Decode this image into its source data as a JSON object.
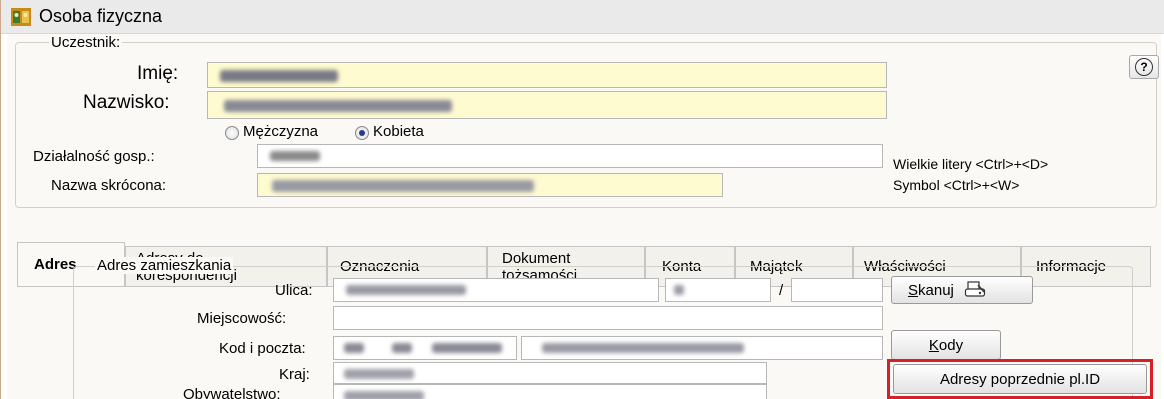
{
  "window": {
    "title": "Osoba fizyczna"
  },
  "participant": {
    "group_label": "Uczestnik:",
    "first_name_label": "Imię:",
    "last_name_label": "Nazwisko:",
    "gender_options": [
      {
        "label": "Mężczyzna",
        "selected": false
      },
      {
        "label": "Kobieta",
        "selected": true
      }
    ],
    "business_label": "Działalność gosp.:",
    "short_name_label": "Nazwa skrócona:",
    "hint_uppercase": "Wielkie litery <Ctrl>+<D>",
    "hint_symbol": "Symbol <Ctrl>+<W>",
    "help_glyph": "?"
  },
  "tabs": [
    {
      "label": "Adres",
      "active": true
    },
    {
      "label_line1": "Adresy do",
      "label_line2": "korespondencji"
    },
    {
      "label": "Oznaczenia"
    },
    {
      "label_line1": "Dokument",
      "label_line2": "tożsamości"
    },
    {
      "label": "Konta"
    },
    {
      "label": "Majątek"
    },
    {
      "label": "Właściwości"
    },
    {
      "label": "Informacje"
    }
  ],
  "address": {
    "group_label": "Adres zamieszkania",
    "street_label": "Ulica:",
    "slash": "/",
    "city_label": "Miejscowość:",
    "postal_label": "Kod i poczta:",
    "country_label": "Kraj:",
    "citizenship_label": "Obywatelstwo:",
    "scan_button": "Skanuj",
    "codes_button": "Kody",
    "prev_addresses_button": "Adresy poprzednie pl.ID"
  },
  "colors": {
    "highlight": "#d61f26",
    "field_yellow": "#fffbd0",
    "radio_dot": "#2a3a8a"
  }
}
